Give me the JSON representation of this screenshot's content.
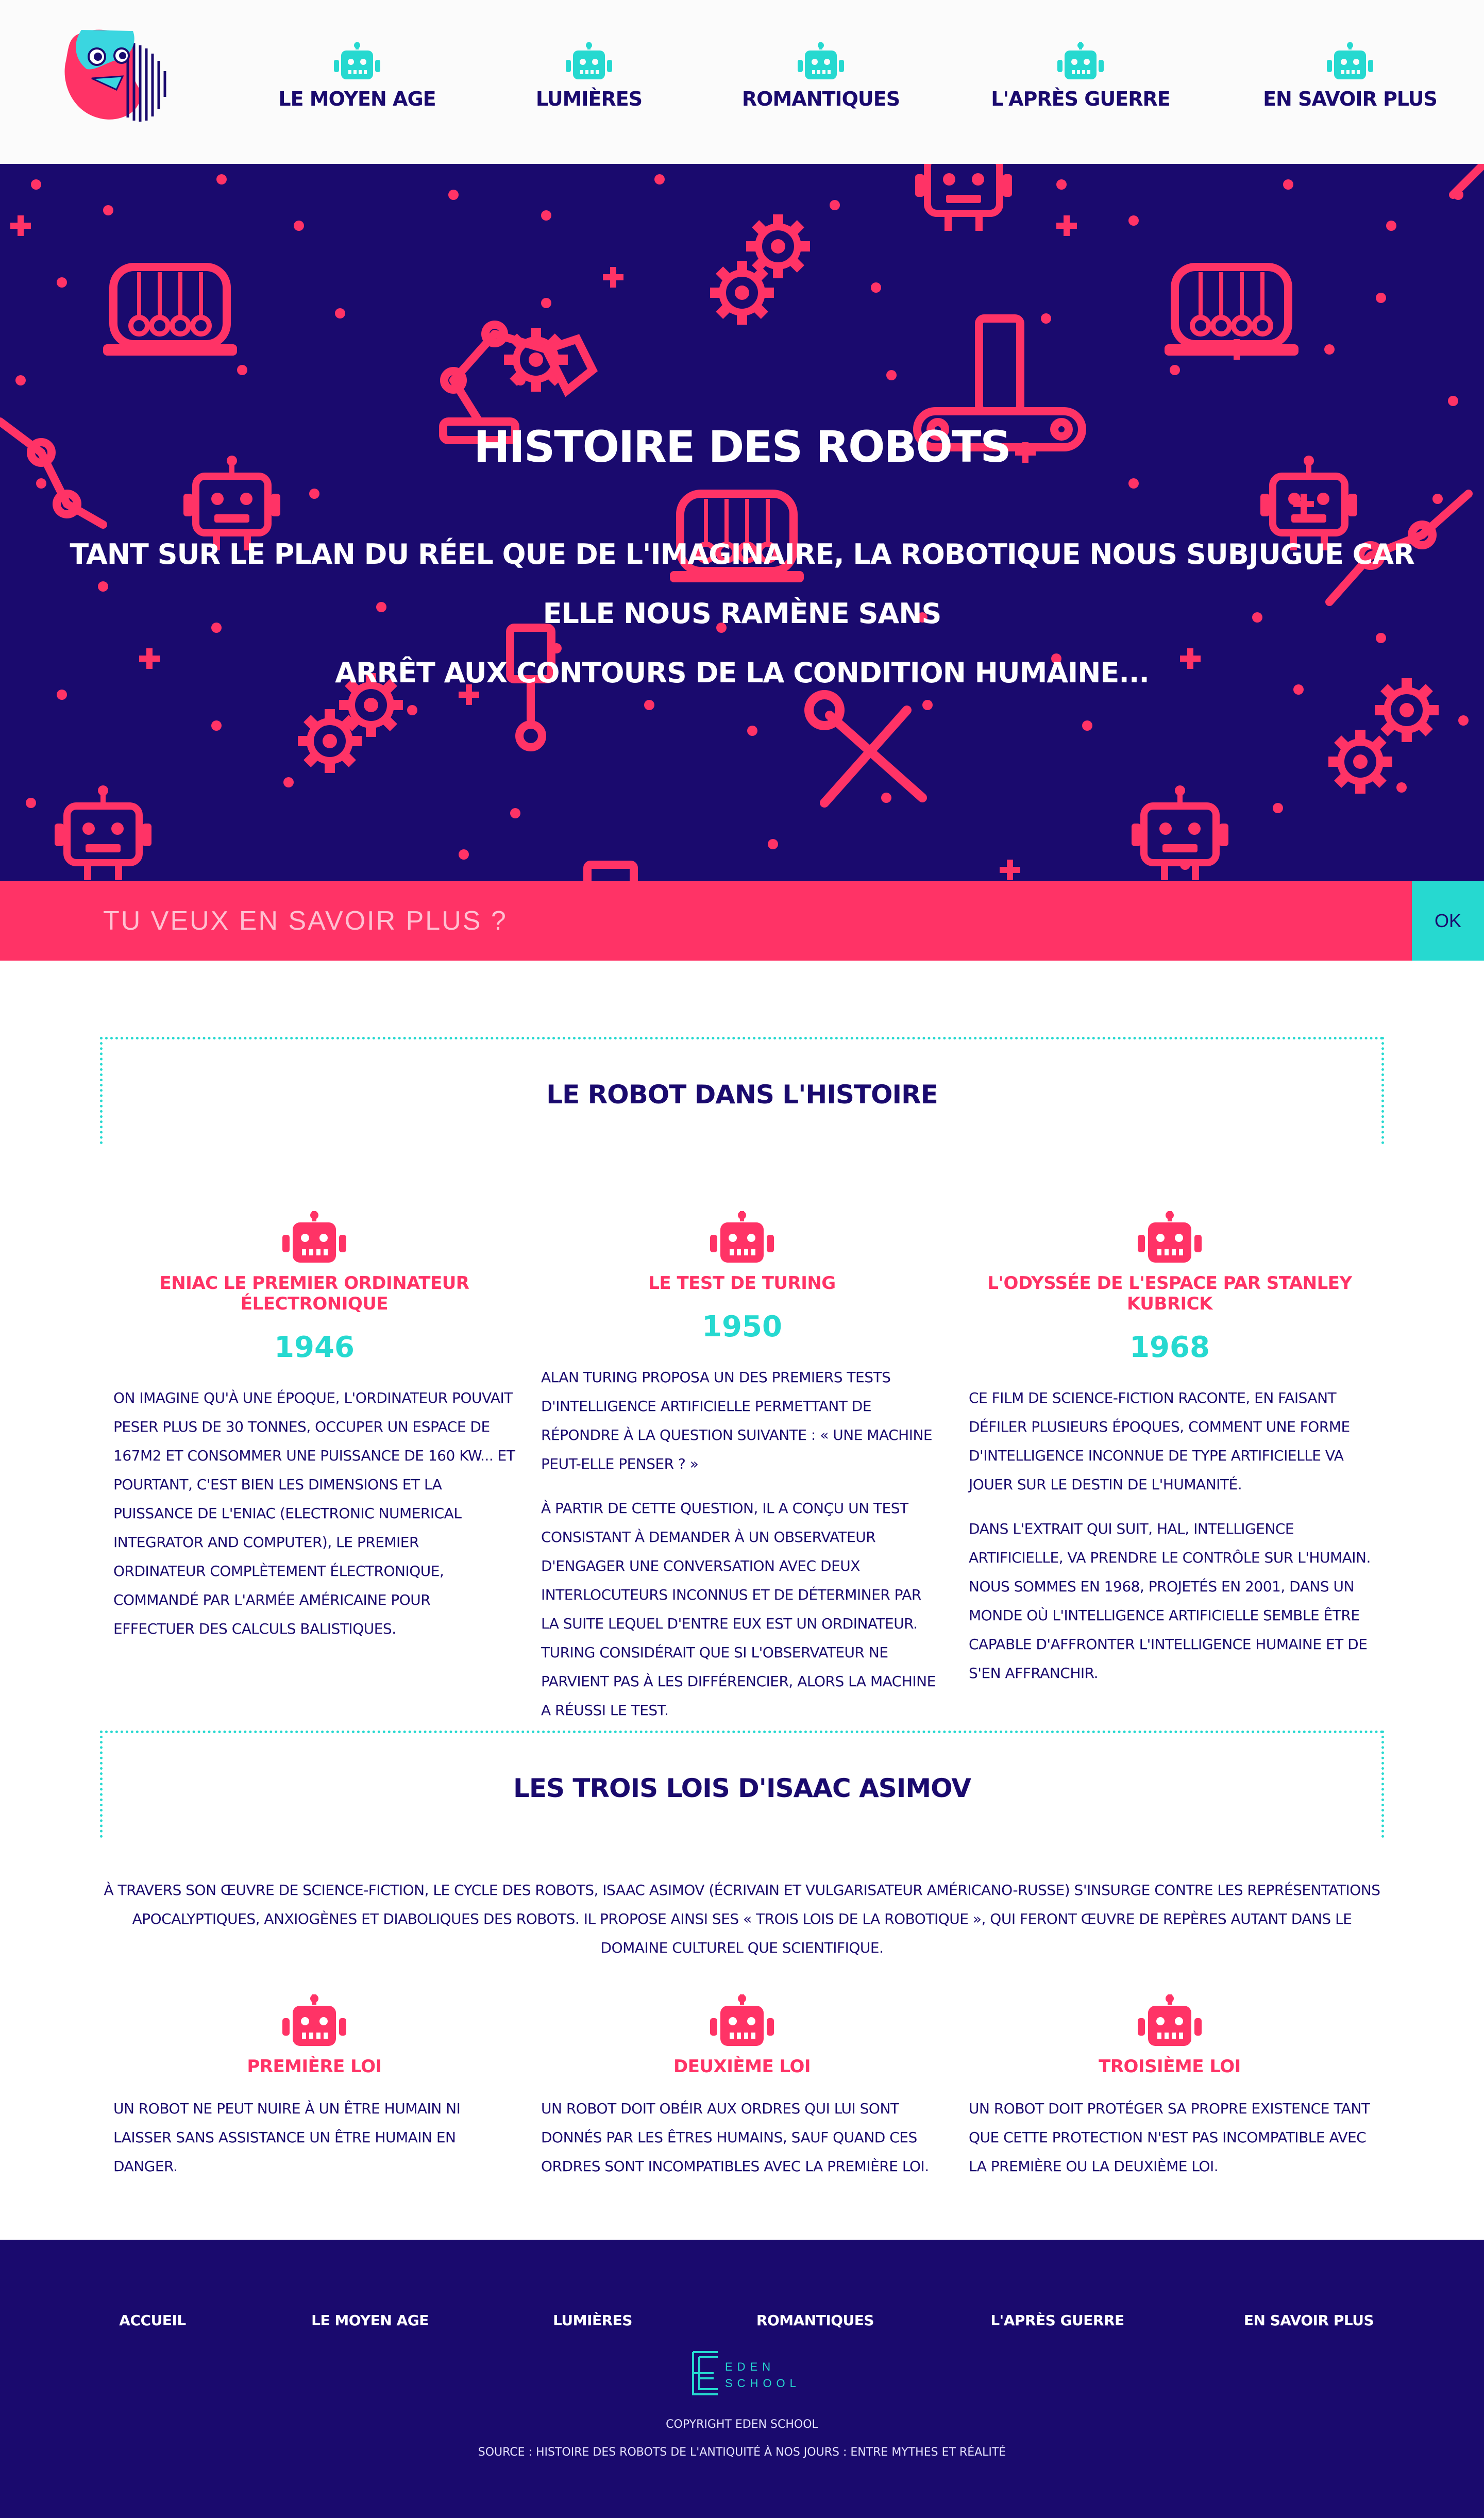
{
  "nav": {
    "items": [
      {
        "label": "LE MOYEN AGE"
      },
      {
        "label": "LUMIÈRES"
      },
      {
        "label": "ROMANTIQUES"
      },
      {
        "label": "L'APRÈS GUERRE"
      },
      {
        "label": "EN SAVOIR PLUS"
      }
    ]
  },
  "hero": {
    "title": "HISTOIRE DES ROBOTS",
    "line1": "TANT SUR LE PLAN DU RÉEL QUE DE L'IMAGINAIRE, LA ROBOTIQUE NOUS SUBJUGUE CAR ELLE NOUS RAMÈNE SANS",
    "line2": "ARRÊT AUX CONTOURS DE LA CONDITION HUMAINE..."
  },
  "newsletter": {
    "placeholder": "TU VEUX EN SAVOIR PLUS ?",
    "button": "OK"
  },
  "history": {
    "title": "LE ROBOT DANS L'HISTOIRE",
    "items": [
      {
        "title": "ENIAC LE PREMIER ORDINATEUR ÉLECTRONIQUE",
        "year": "1946",
        "p1": "On imagine qu'à une époque, l'ordinateur pouvait peser plus de 30 tonnes, occuper un espace de 167m2 et consommer une puissance de 160 kW... Et pourtant, c'est bien les dimensions et la puissance de l'ENIAC (Electronic Numerical Integrator And Computer), le premier ordinateur complètement électronique, commandé par l'Armée Américaine pour effectuer des calculs balistiques.",
        "p2": ""
      },
      {
        "title": "LE TEST DE TURING",
        "year": "1950",
        "p1": "Alan Turing proposa un des premiers tests d'intelligence artificielle permettant de répondre à la question suivante : « une machine peut-elle penser ? »",
        "p2": "À partir de cette question, il a conçu un test consistant à demander à un observateur d'engager une conversation avec deux interlocuteurs inconnus et de déterminer par la suite lequel d'entre eux est un ordinateur. Turing considérait que si l'observateur ne parvient pas à les différencier, alors la machine a réussi le test."
      },
      {
        "title": "L'ODYSSÉE DE L'ESPACE PAR STANLEY KUBRICK",
        "year": "1968",
        "p1": "Ce film de science-fiction raconte, en faisant défiler plusieurs époques, comment une forme d'intelligence inconnue de type artificielle va jouer sur le destin de l'humanité.",
        "p2": "Dans l'extrait qui suit, HAL, intelligence artificielle, va prendre le contrôle sur l'humain. Nous sommes en 1968, projetés en 2001, dans un monde où l'intelligence artificielle semble être capable d'affronter l'intelligence humaine et de s'en affranchir."
      }
    ]
  },
  "asimov": {
    "title": "LES TROIS LOIS D'ISAAC ASIMOV",
    "intro": "À travers son œuvre de science-fiction, Le Cycle des Robots, Isaac Asimov (écrivain et vulgarisateur américano-russe) s'insurge contre les représentations apocalyptiques, anxiogènes et diaboliques des robots. Il propose ainsi ses « trois lois de la robotique », qui feront œuvre de repères autant dans le domaine culturel que scientifique.",
    "laws": [
      {
        "title": "PREMIÈRE LOI",
        "text": "Un robot ne peut nuire à un être humain ni laisser sans assistance un être humain en danger."
      },
      {
        "title": "DEUXIÈME LOI",
        "text": "Un robot doit obéir aux ordres qui lui sont donnés par les êtres humains, sauf quand ces ordres sont incompatibles avec la première loi."
      },
      {
        "title": "TROISIÈME LOI",
        "text": "Un robot doit protéger sa propre existence tant que cette protection n'est pas incompatible avec la première ou la deuxième loi."
      }
    ]
  },
  "footer": {
    "links": [
      {
        "label": "ACCUEIL"
      },
      {
        "label": "LE MOYEN AGE"
      },
      {
        "label": "LUMIÈRES"
      },
      {
        "label": "ROMANTIQUES"
      },
      {
        "label": "L'APRÈS GUERRE"
      },
      {
        "label": "EN SAVOIR PLUS"
      }
    ],
    "logo_line1": "EDEN",
    "logo_line2": "SCHOOL",
    "copyright": "Copyright Eden School",
    "source": "Source : Histoire des robots de l'Antiquité à nos jours : entre mythes et réalité"
  },
  "colors": {
    "navy": "#1a0a6e",
    "pink": "#ff3366",
    "cyan": "#26d9d0"
  }
}
